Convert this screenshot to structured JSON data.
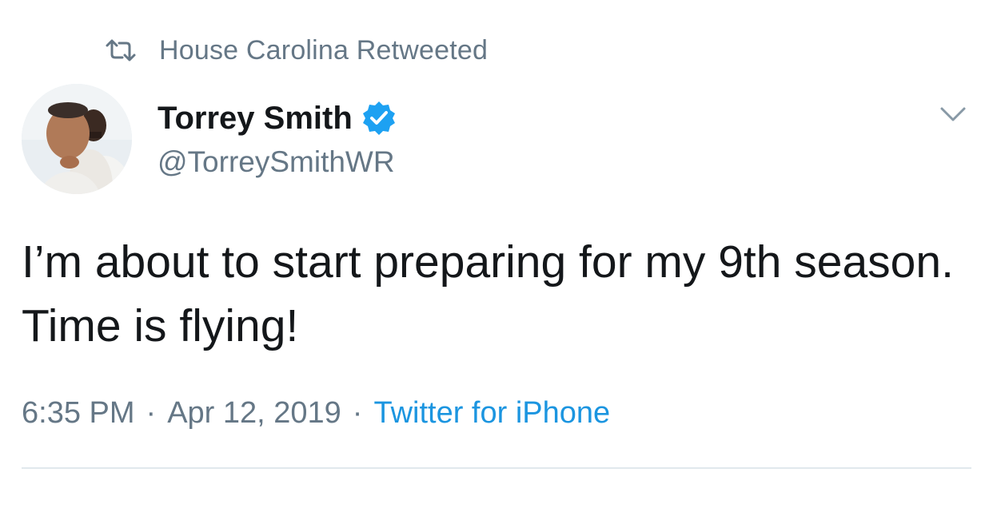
{
  "retweet": {
    "icon": "retweet-icon",
    "label": "House Carolina Retweeted"
  },
  "author": {
    "avatar_icon": "avatar",
    "display_name": "Torrey Smith",
    "verified_icon": "verified-badge-icon",
    "handle": "@TorreySmithWR"
  },
  "menu": {
    "icon": "chevron-down-icon"
  },
  "tweet": {
    "text": "I’m about to start preparing for my 9th season. Time is flying!"
  },
  "meta": {
    "time": "6:35 PM",
    "separator": "·",
    "date": "Apr 12, 2019",
    "source": "Twitter for iPhone"
  },
  "colors": {
    "text_primary": "#14171a",
    "text_secondary": "#657786",
    "link": "#1b95e0",
    "verified": "#1da1f2",
    "divider": "#e1e8ed"
  }
}
